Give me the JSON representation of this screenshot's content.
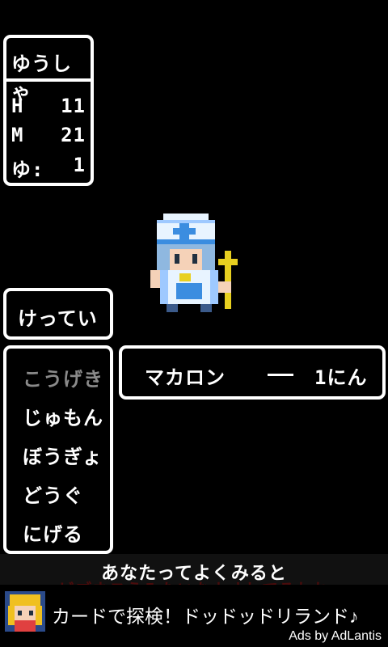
{
  "status": {
    "name": "ゆうしゃ",
    "h_label": "H",
    "h_value": "11",
    "m_label": "M",
    "m_value": "21",
    "g_label": "ゆ:",
    "g_value": "1"
  },
  "decision": {
    "label": "けってい"
  },
  "commands": [
    {
      "label": "こうげき"
    },
    {
      "label": "じゅもん"
    },
    {
      "label": "ぼうぎょ"
    },
    {
      "label": "どうぐ"
    },
    {
      "label": "にげる"
    }
  ],
  "enemy": {
    "name": "マカロン",
    "count": "1にん"
  },
  "message": {
    "line1": "あなたってよくみると",
    "line2": "ビブネスうみたいなカオしてるわね"
  },
  "ad": {
    "text": "カードで探検！ドッドッドリランド♪",
    "by": "Ads by AdLantis"
  },
  "colors": {
    "background": "#000000",
    "text": "#ffffff",
    "dim_text": "#8a8a8a",
    "hat": "#e8f4ff",
    "hat_cross": "#3b8de0",
    "staff": "#e8d020"
  }
}
